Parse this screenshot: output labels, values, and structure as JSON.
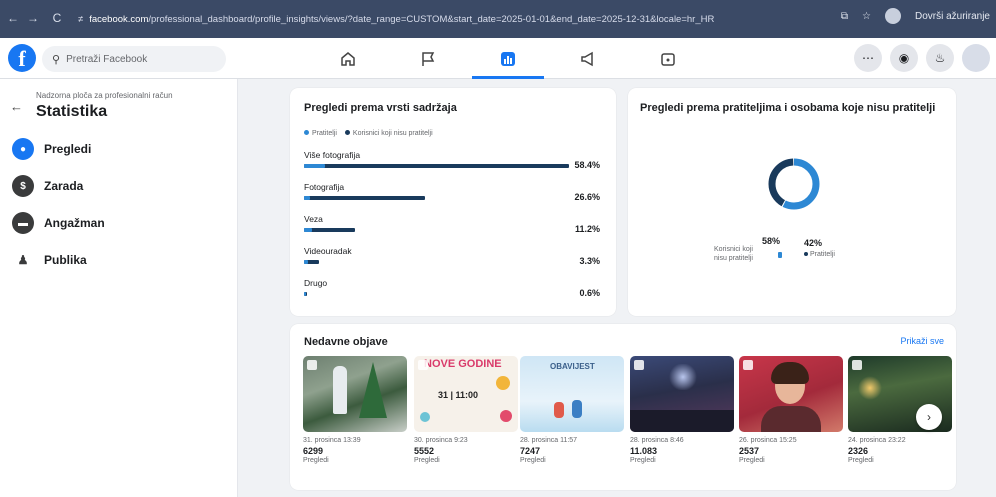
{
  "browser": {
    "back": "←",
    "forward": "→",
    "reload": "C",
    "lock": "≠",
    "url_host": "facebook.com",
    "url_path": "/professional_dashboard/profile_insights/views/?date_range=CUSTOM&start_date=2025-01-01&end_date=2025-12-31&locale=hr_HR",
    "right_label": "Dovrši ažuriranje"
  },
  "fb": {
    "logo": "f",
    "search_placeholder": "Pretraži Facebook"
  },
  "sidebar": {
    "breadcrumb": "Nadzorna ploča za profesionalni račun",
    "title": "Statistika",
    "items": [
      {
        "label": "Pregledi",
        "icon": "eye-icon"
      },
      {
        "label": "Zarada",
        "icon": "dollar-icon"
      },
      {
        "label": "Angažman",
        "icon": "chat-icon"
      },
      {
        "label": "Publika",
        "icon": "people-icon"
      }
    ]
  },
  "content_types": {
    "title": "Pregledi prema vrsti sadržaja",
    "legend": [
      "Pratitelji",
      "Korisnici koji nisu pratitelji"
    ],
    "rows": [
      {
        "label": "Više fotografija",
        "pct": "58.4%"
      },
      {
        "label": "Fotografija",
        "pct": "26.6%"
      },
      {
        "label": "Veza",
        "pct": "11.2%"
      },
      {
        "label": "Videouradak",
        "pct": "3.3%"
      },
      {
        "label": "Drugo",
        "pct": "0.6%"
      }
    ]
  },
  "followers": {
    "title": "Pregledi prema pratiteljima i osobama koje nisu pratitelji",
    "non_followers_pct": "58%",
    "non_followers_label": "Korisnici koji nisu pratitelji",
    "followers_pct": "42%",
    "followers_label": "Pratitelji"
  },
  "recent": {
    "title": "Nedavne objave",
    "show_all": "Prikaži sve",
    "posts": [
      {
        "date": "31. prosinca 13:39",
        "views": "6299",
        "metric": "Pregledi"
      },
      {
        "date": "30. prosinca 9:23",
        "views": "5552",
        "metric": "Pregledi",
        "thumb_text_1": "NOVE GODINE",
        "thumb_text_2": "31 | 11:00"
      },
      {
        "date": "28. prosinca 11:57",
        "views": "7247",
        "metric": "Pregledi",
        "thumb_text_1": "OBAVIJEST"
      },
      {
        "date": "28. prosinca 8:46",
        "views": "11.083",
        "metric": "Pregledi"
      },
      {
        "date": "26. prosinca 15:25",
        "views": "2537",
        "metric": "Pregledi"
      },
      {
        "date": "24. prosinca 23:22",
        "views": "2326",
        "metric": "Pregledi"
      }
    ]
  },
  "chart_data": [
    {
      "type": "bar",
      "title": "Pregledi prema vrsti sadržaja",
      "categories": [
        "Više fotografija",
        "Fotografija",
        "Veza",
        "Videouradak",
        "Drugo"
      ],
      "values": [
        58.4,
        26.6,
        11.2,
        3.3,
        0.6
      ],
      "follower_share": [
        0.08,
        0.05,
        0.15,
        0.3,
        0.5
      ],
      "legend": [
        "Pratitelji",
        "Korisnici koji nisu pratitelji"
      ],
      "colors": [
        "#2d88d4",
        "#193a5c"
      ]
    },
    {
      "type": "pie",
      "title": "Pregledi prema pratiteljima i osobama koje nisu pratitelji",
      "categories": [
        "Korisnici koji nisu pratitelji",
        "Pratitelji"
      ],
      "values": [
        58,
        42
      ],
      "colors": [
        "#2d88d4",
        "#193a5c"
      ]
    }
  ]
}
